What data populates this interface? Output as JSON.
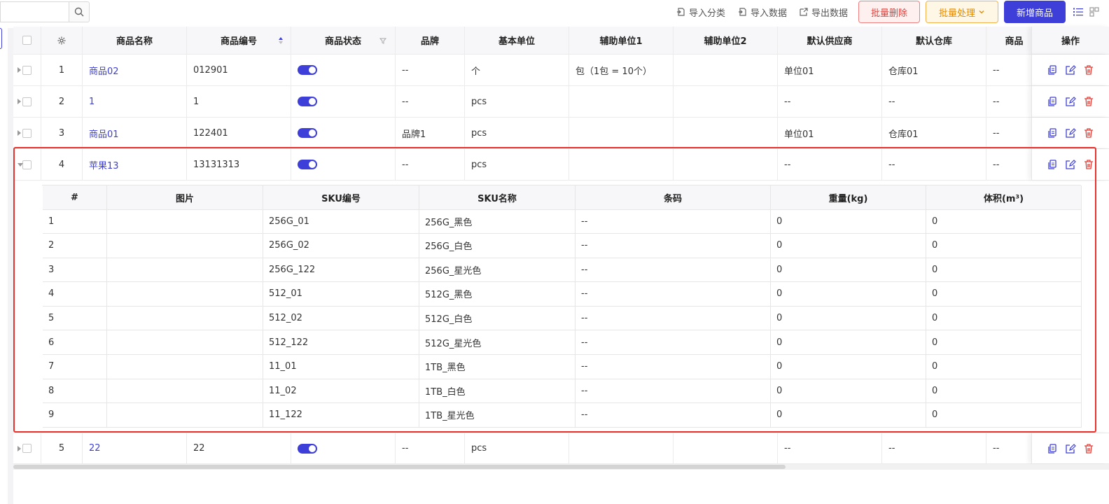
{
  "toolbar": {
    "search_placeholder": "",
    "import_category": "导入分类",
    "import_data": "导入数据",
    "export_data": "导出数据",
    "batch_delete": "批量删除",
    "batch_process": "批量处理",
    "add_product": "新增商品"
  },
  "columns": {
    "name": "商品名称",
    "code": "商品编号",
    "status": "商品状态",
    "brand": "品牌",
    "unit": "基本单位",
    "aux1": "辅助单位1",
    "aux2": "辅助单位2",
    "supplier": "默认供应商",
    "warehouse": "默认仓库",
    "more": "商品",
    "actions": "操作"
  },
  "rows": [
    {
      "idx": "1",
      "name": "商品02",
      "code": "012901",
      "brand": "--",
      "unit": "个",
      "aux1": "包（1包 = 10个）",
      "aux2": "",
      "supplier": "单位01",
      "warehouse": "仓库01",
      "more": "--"
    },
    {
      "idx": "2",
      "name": "1",
      "code": "1",
      "brand": "--",
      "unit": "pcs",
      "aux1": "",
      "aux2": "",
      "supplier": "--",
      "warehouse": "--",
      "more": "--"
    },
    {
      "idx": "3",
      "name": "商品01",
      "code": "122401",
      "brand": "品牌1",
      "unit": "pcs",
      "aux1": "",
      "aux2": "",
      "supplier": "单位01",
      "warehouse": "仓库01",
      "more": "--"
    },
    {
      "idx": "4",
      "name": "苹果13",
      "code": "13131313",
      "brand": "--",
      "unit": "pcs",
      "aux1": "",
      "aux2": "",
      "supplier": "--",
      "warehouse": "--",
      "more": "--"
    },
    {
      "idx": "5",
      "name": "22",
      "code": "22",
      "brand": "--",
      "unit": "pcs",
      "aux1": "",
      "aux2": "",
      "supplier": "--",
      "warehouse": "--",
      "more": "--"
    }
  ],
  "sku_columns": {
    "num": "#",
    "image": "图片",
    "sku_code": "SKU编号",
    "sku_name": "SKU名称",
    "barcode": "条码",
    "weight": "重量(kg)",
    "volume": "体积(m³)"
  },
  "skus": [
    {
      "num": "1",
      "image": "",
      "code": "256G_01",
      "name": "256G_黑色",
      "barcode": "--",
      "weight": "0",
      "volume": "0"
    },
    {
      "num": "2",
      "image": "",
      "code": "256G_02",
      "name": "256G_白色",
      "barcode": "--",
      "weight": "0",
      "volume": "0"
    },
    {
      "num": "3",
      "image": "",
      "code": "256G_122",
      "name": "256G_星光色",
      "barcode": "--",
      "weight": "0",
      "volume": "0"
    },
    {
      "num": "4",
      "image": "",
      "code": "512_01",
      "name": "512G_黑色",
      "barcode": "--",
      "weight": "0",
      "volume": "0"
    },
    {
      "num": "5",
      "image": "",
      "code": "512_02",
      "name": "512G_白色",
      "barcode": "--",
      "weight": "0",
      "volume": "0"
    },
    {
      "num": "6",
      "image": "",
      "code": "512_122",
      "name": "512G_星光色",
      "barcode": "--",
      "weight": "0",
      "volume": "0"
    },
    {
      "num": "7",
      "image": "",
      "code": "11_01",
      "name": "1TB_黑色",
      "barcode": "--",
      "weight": "0",
      "volume": "0"
    },
    {
      "num": "8",
      "image": "",
      "code": "11_02",
      "name": "1TB_白色",
      "barcode": "--",
      "weight": "0",
      "volume": "0"
    },
    {
      "num": "9",
      "image": "",
      "code": "11_122",
      "name": "1TB_星光色",
      "barcode": "--",
      "weight": "0",
      "volume": "0"
    }
  ],
  "colors": {
    "accent": "#3d3fd8",
    "danger": "#e0403a",
    "warning": "#e08a00",
    "highlight_border": "#e8322b"
  },
  "icons": [
    "search-icon",
    "import-icon",
    "export-icon",
    "chevron-down-icon",
    "list-view-icon",
    "grid-view-icon",
    "settings-gear-icon",
    "sort-icon",
    "filter-icon",
    "copy-icon",
    "edit-icon",
    "delete-icon"
  ]
}
